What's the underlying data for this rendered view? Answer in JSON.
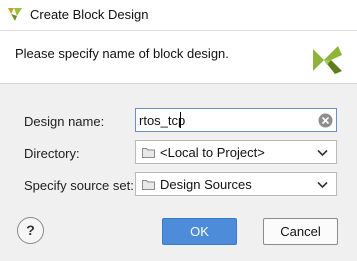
{
  "window": {
    "title": "Create Block Design",
    "icon": "vivado-logo-icon"
  },
  "header": {
    "text": "Please specify name of block design.",
    "logo": "xilinx-logo-icon"
  },
  "form": {
    "design_name": {
      "label": "Design name:",
      "value": "rtos_tcp"
    },
    "directory": {
      "label": "Directory:",
      "value": "<Local to Project>",
      "icon": "folder-icon"
    },
    "source_set": {
      "label": "Specify source set:",
      "value": "Design Sources",
      "icon": "folder-icon"
    }
  },
  "footer": {
    "help_label": "?",
    "ok_label": "OK",
    "cancel_label": "Cancel"
  },
  "colors": {
    "accent": "#4d8cd9",
    "logo_green": "#8fb43a",
    "logo_dark": "#5d7e1e"
  }
}
